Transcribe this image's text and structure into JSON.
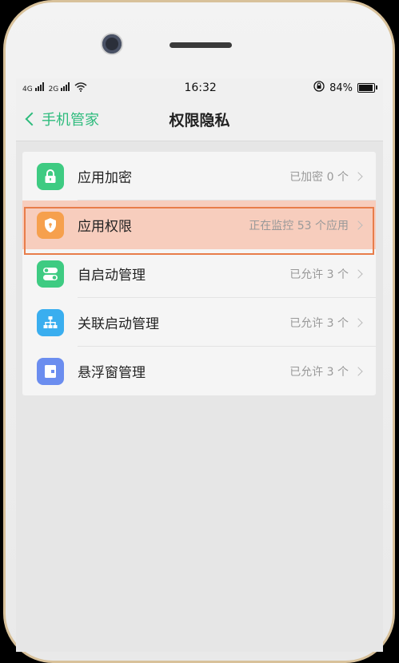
{
  "status_bar": {
    "left_labels": [
      "4G",
      "2G"
    ],
    "time": "16:32",
    "battery": "84%"
  },
  "header": {
    "back_label": "手机管家",
    "title": "权限隐私"
  },
  "menu": [
    {
      "label": "应用加密",
      "value": "已加密 0 个",
      "icon": "lock-icon",
      "color": "#3ecb82"
    },
    {
      "label": "应用权限",
      "value": "正在监控 53 个应用",
      "icon": "shield-icon",
      "color": "#f6a04d"
    },
    {
      "label": "自启动管理",
      "value": "已允许 3 个",
      "icon": "toggle-icon",
      "color": "#3ecb82"
    },
    {
      "label": "关联启动管理",
      "value": "已允许 3 个",
      "icon": "hierarchy-icon",
      "color": "#3aaeef"
    },
    {
      "label": "悬浮窗管理",
      "value": "已允许 3 个",
      "icon": "floating-window-icon",
      "color": "#6b8def"
    }
  ],
  "highlighted_index": 1
}
